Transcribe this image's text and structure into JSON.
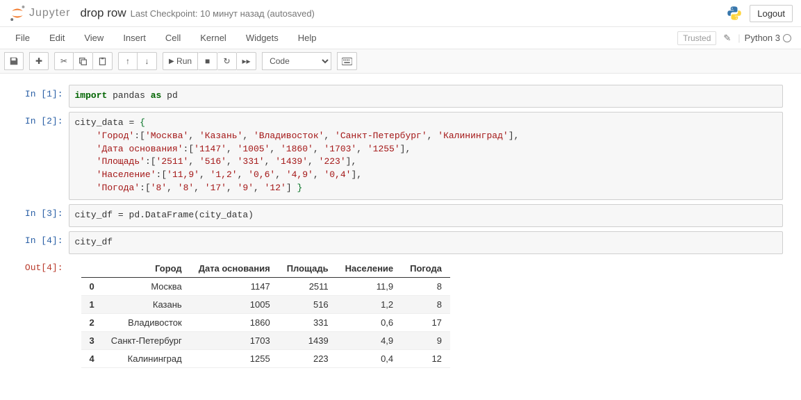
{
  "header": {
    "logo_text": "Jupyter",
    "notebook_name": "drop row",
    "checkpoint": "Last Checkpoint: 10 минут назад  (autosaved)",
    "logout": "Logout"
  },
  "menubar": {
    "items": [
      "File",
      "Edit",
      "View",
      "Insert",
      "Cell",
      "Kernel",
      "Widgets",
      "Help"
    ],
    "trusted": "Trusted",
    "kernel": "Python 3"
  },
  "toolbar": {
    "run": "Run",
    "celltype": "Code"
  },
  "cells": [
    {
      "in": "In [1]:",
      "code_html": "<span class='k-green'>import</span> pandas <span class='k-green'>as</span> pd"
    },
    {
      "in": "In [2]:",
      "code_html": "city_data = <span class='k-brace'>{</span>\n    <span class='k-str'>'Город'</span>:[<span class='k-str'>'Москва'</span>, <span class='k-str'>'Казань'</span>, <span class='k-str'>'Владивосток'</span>, <span class='k-str'>'Санкт-Петербург'</span>, <span class='k-str'>'Калининград'</span>],\n    <span class='k-str'>'Дата основания'</span>:[<span class='k-str'>'1147'</span>, <span class='k-str'>'1005'</span>, <span class='k-str'>'1860'</span>, <span class='k-str'>'1703'</span>, <span class='k-str'>'1255'</span>],\n    <span class='k-str'>'Площадь'</span>:[<span class='k-str'>'2511'</span>, <span class='k-str'>'516'</span>, <span class='k-str'>'331'</span>, <span class='k-str'>'1439'</span>, <span class='k-str'>'223'</span>],\n    <span class='k-str'>'Население'</span>:[<span class='k-str'>'11,9'</span>, <span class='k-str'>'1,2'</span>, <span class='k-str'>'0,6'</span>, <span class='k-str'>'4,9'</span>, <span class='k-str'>'0,4'</span>],\n    <span class='k-str'>'Погода'</span>:[<span class='k-str'>'8'</span>, <span class='k-str'>'8'</span>, <span class='k-str'>'17'</span>, <span class='k-str'>'9'</span>, <span class='k-str'>'12'</span>] <span class='k-brace'>}</span>"
    },
    {
      "in": "In [3]:",
      "code_html": "city_df = pd.DataFrame(city_data)"
    },
    {
      "in": "In [4]:",
      "code_html": "city_df"
    }
  ],
  "output4": {
    "label": "Out[4]:",
    "columns": [
      "Город",
      "Дата основания",
      "Площадь",
      "Население",
      "Погода"
    ],
    "index": [
      "0",
      "1",
      "2",
      "3",
      "4"
    ],
    "rows": [
      [
        "Москва",
        "1147",
        "2511",
        "11,9",
        "8"
      ],
      [
        "Казань",
        "1005",
        "516",
        "1,2",
        "8"
      ],
      [
        "Владивосток",
        "1860",
        "331",
        "0,6",
        "17"
      ],
      [
        "Санкт-Петербург",
        "1703",
        "1439",
        "4,9",
        "9"
      ],
      [
        "Калининград",
        "1255",
        "223",
        "0,4",
        "12"
      ]
    ]
  }
}
